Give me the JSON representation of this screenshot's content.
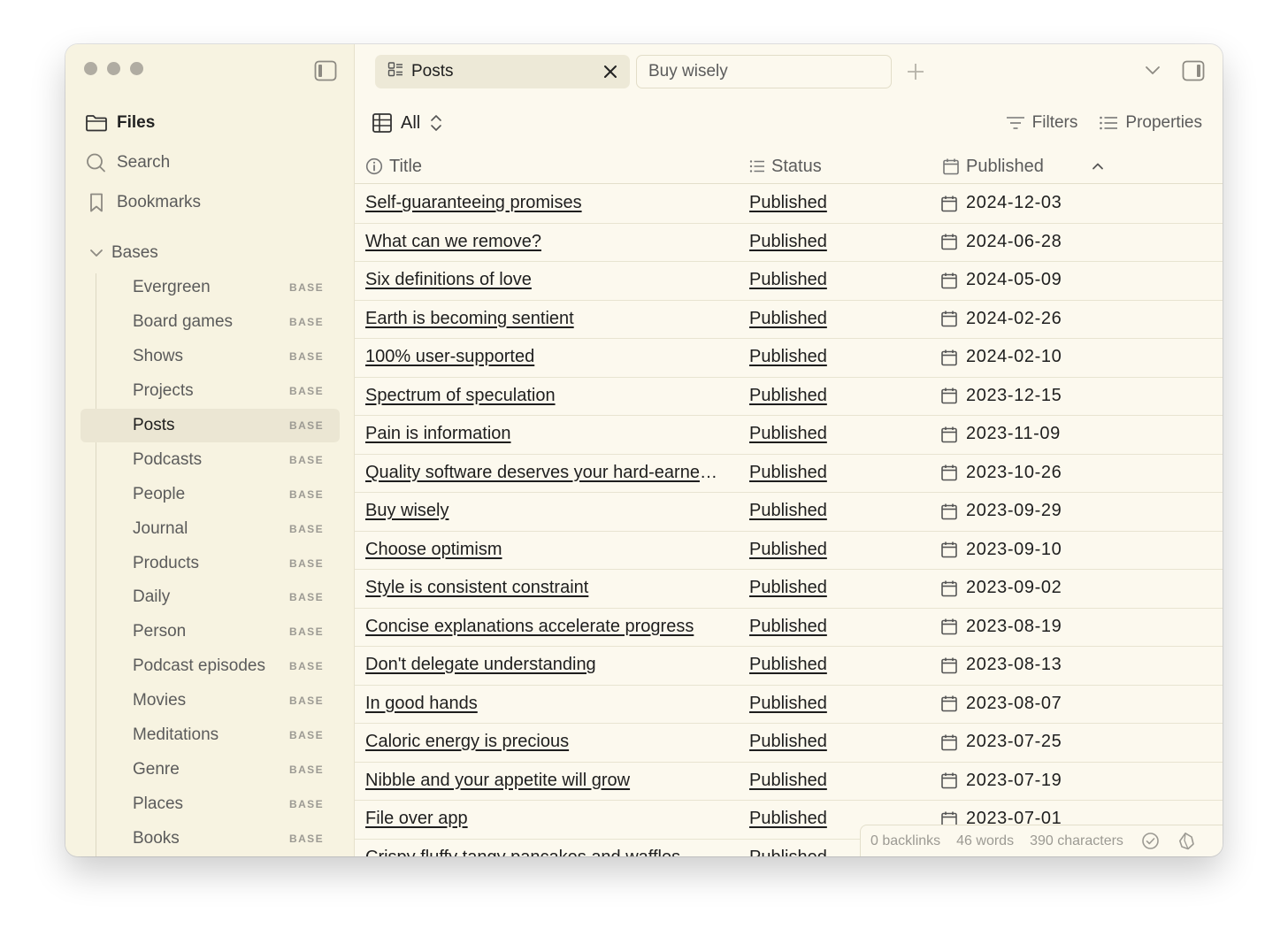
{
  "sidebar": {
    "nav": {
      "files": "Files",
      "search": "Search",
      "bookmarks": "Bookmarks"
    },
    "bases_header": "Bases",
    "base_tag": "BASE",
    "bases": [
      {
        "label": "Evergreen",
        "active": false
      },
      {
        "label": "Board games",
        "active": false
      },
      {
        "label": "Shows",
        "active": false
      },
      {
        "label": "Projects",
        "active": false
      },
      {
        "label": "Posts",
        "active": true
      },
      {
        "label": "Podcasts",
        "active": false
      },
      {
        "label": "People",
        "active": false
      },
      {
        "label": "Journal",
        "active": false
      },
      {
        "label": "Products",
        "active": false
      },
      {
        "label": "Daily",
        "active": false
      },
      {
        "label": "Person",
        "active": false
      },
      {
        "label": "Podcast episodes",
        "active": false
      },
      {
        "label": "Movies",
        "active": false
      },
      {
        "label": "Meditations",
        "active": false
      },
      {
        "label": "Genre",
        "active": false
      },
      {
        "label": "Places",
        "active": false
      },
      {
        "label": "Books",
        "active": false
      }
    ]
  },
  "tabs": [
    {
      "label": "Posts",
      "active": true
    },
    {
      "label": "Buy wisely",
      "active": false
    }
  ],
  "toolbar": {
    "view_label": "All",
    "filters_label": "Filters",
    "properties_label": "Properties"
  },
  "table": {
    "columns": {
      "title": "Title",
      "status": "Status",
      "published": "Published"
    },
    "rows": [
      {
        "title": "Self-guaranteeing promises",
        "status": "Published",
        "date": "2024-12-03"
      },
      {
        "title": "What can we remove?",
        "status": "Published",
        "date": "2024-06-28"
      },
      {
        "title": "Six definitions of love",
        "status": "Published",
        "date": "2024-05-09"
      },
      {
        "title": "Earth is becoming sentient",
        "status": "Published",
        "date": "2024-02-26"
      },
      {
        "title": "100% user-supported",
        "status": "Published",
        "date": "2024-02-10"
      },
      {
        "title": "Spectrum of speculation",
        "status": "Published",
        "date": "2023-12-15"
      },
      {
        "title": "Pain is information",
        "status": "Published",
        "date": "2023-11-09"
      },
      {
        "title": "Quality software deserves your hard-earned money",
        "status": "Published",
        "date": "2023-10-26"
      },
      {
        "title": "Buy wisely",
        "status": "Published",
        "date": "2023-09-29"
      },
      {
        "title": "Choose optimism",
        "status": "Published",
        "date": "2023-09-10"
      },
      {
        "title": "Style is consistent constraint",
        "status": "Published",
        "date": "2023-09-02"
      },
      {
        "title": "Concise explanations accelerate progress",
        "status": "Published",
        "date": "2023-08-19"
      },
      {
        "title": "Don't delegate understanding",
        "status": "Published",
        "date": "2023-08-13"
      },
      {
        "title": "In good hands",
        "status": "Published",
        "date": "2023-08-07"
      },
      {
        "title": "Caloric energy is precious",
        "status": "Published",
        "date": "2023-07-25"
      },
      {
        "title": "Nibble and your appetite will grow",
        "status": "Published",
        "date": "2023-07-19"
      },
      {
        "title": "File over app",
        "status": "Published",
        "date": "2023-07-01"
      },
      {
        "title": "Crispy fluffy tangy pancakes and waffles",
        "status": "Published",
        "date": ""
      }
    ]
  },
  "status_bar": {
    "backlinks": "0 backlinks",
    "words": "46 words",
    "characters": "390 characters"
  },
  "icons": {
    "folder": "folder-icon",
    "search": "search-icon",
    "bookmark": "bookmark-icon",
    "chevron": "chevron-down-icon",
    "table": "table-icon",
    "filter": "filter-icon",
    "list": "list-icon",
    "calendar": "calendar-icon",
    "info": "info-icon"
  }
}
